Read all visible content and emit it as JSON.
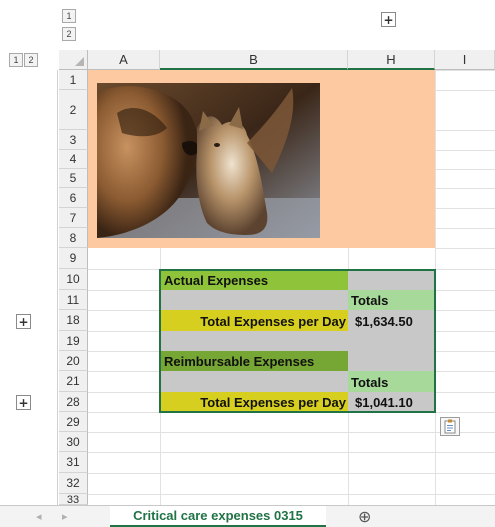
{
  "outline": {
    "column_levels": [
      "1",
      "2"
    ],
    "row_levels": [
      "1",
      "2"
    ],
    "expand_column_symbol": "+",
    "expand_row_symbol": "+"
  },
  "columns": [
    "A",
    "B",
    "H",
    "I"
  ],
  "rows": [
    "1",
    "2",
    "3",
    "4",
    "5",
    "6",
    "7",
    "8",
    "9",
    "10",
    "11",
    "18",
    "19",
    "20",
    "21",
    "28",
    "29",
    "30",
    "31",
    "32",
    "33"
  ],
  "cells": {
    "actual_expenses": "Actual Expenses",
    "totals_1": "Totals",
    "total_per_day_1": "Total Expenses per Day",
    "total_value_1": "$1,634.50",
    "reimbursable_expenses": "Reimbursable Expenses",
    "totals_2": "Totals",
    "total_per_day_2": "Total Expenses per Day",
    "total_value_2": "$1,041.10"
  },
  "sheet_tabs": {
    "active_tab": "Critical care expenses 0315",
    "add_sheet_symbol": "⊕",
    "nav_prev": "◂",
    "nav_next": "▸"
  },
  "colors": {
    "peach_fill": "#fdc9a0",
    "green_header": "#8fc43a",
    "dark_green_header": "#76a633",
    "totals_green": "#a6d99a",
    "gray_fill": "#c8c8c8",
    "yellow_fill": "#d7cf1f",
    "accent": "#217346"
  }
}
